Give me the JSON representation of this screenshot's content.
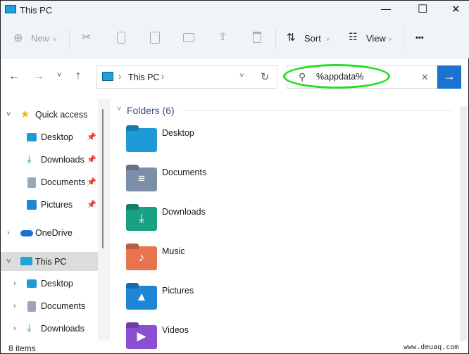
{
  "window": {
    "title": "This PC",
    "minimize": "—",
    "maximize": "☐",
    "close": "✕"
  },
  "toolbar": {
    "new_label": "New",
    "sort_label": "Sort",
    "view_label": "View",
    "more": "•••"
  },
  "nav_buttons": {
    "back": "←",
    "forward": "→",
    "recent": "˅",
    "up": "↑"
  },
  "address": {
    "path": "This PC",
    "sep": "›",
    "dropdown": "˅",
    "refresh": "↻"
  },
  "search": {
    "value": "%appdata%",
    "clear": "✕",
    "go": "→",
    "highlight_color": "#22dd22"
  },
  "sidebar": {
    "items": [
      {
        "label": "Quick access",
        "expanded": true
      },
      {
        "label": "Desktop",
        "pinned": true
      },
      {
        "label": "Downloads",
        "pinned": true
      },
      {
        "label": "Documents",
        "pinned": true
      },
      {
        "label": "Pictures",
        "pinned": true
      },
      {
        "label": "OneDrive"
      },
      {
        "label": "This PC",
        "selected": true
      },
      {
        "label": "Desktop"
      },
      {
        "label": "Documents"
      },
      {
        "label": "Downloads"
      }
    ]
  },
  "content": {
    "group_label": "Folders (6)",
    "folders": [
      {
        "name": "Desktop",
        "color": "#1e9bd7"
      },
      {
        "name": "Documents",
        "color": "#7d8fa8"
      },
      {
        "name": "Downloads",
        "color": "#1aa082"
      },
      {
        "name": "Music",
        "color": "#e8734f"
      },
      {
        "name": "Pictures",
        "color": "#1d87d6"
      },
      {
        "name": "Videos",
        "color": "#8a4fd0"
      }
    ]
  },
  "status": {
    "count": "8 items"
  },
  "watermark": "www.deuaq.com"
}
